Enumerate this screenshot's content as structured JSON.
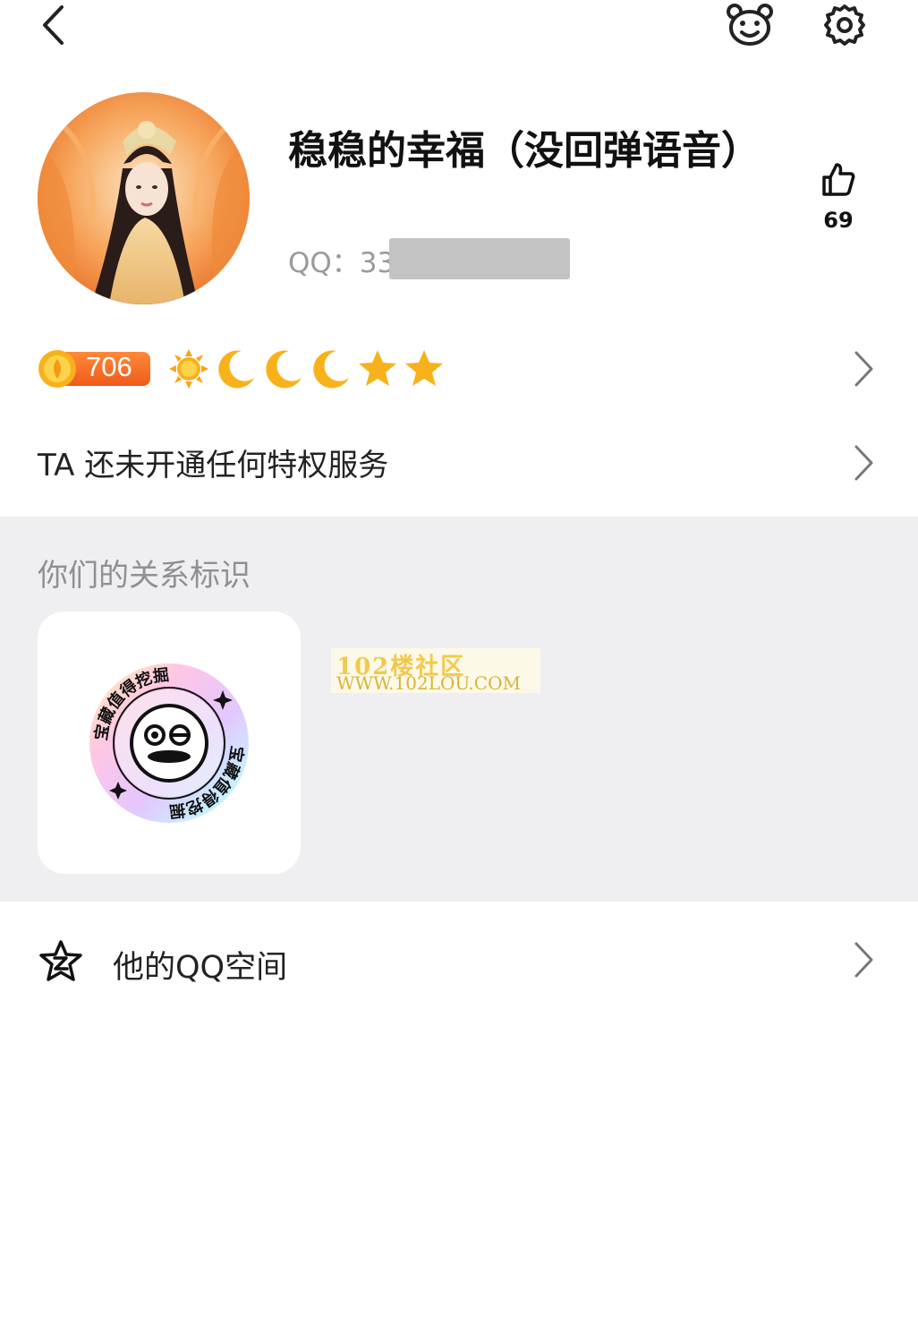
{
  "header": {
    "back_icon": "chevron-left-icon",
    "pet_icon": "bear-face-icon",
    "settings_icon": "gear-icon"
  },
  "profile": {
    "nickname": "稳稳的幸福（没回弹语音）",
    "qq_label": "QQ：33",
    "likes": "69",
    "like_icon": "thumbs-up-icon"
  },
  "level": {
    "value": "706",
    "icons": [
      "sun-icon",
      "moon-icon",
      "moon-icon",
      "moon-icon",
      "star-icon",
      "star-icon"
    ]
  },
  "privilege": {
    "text": "TA 还未开通任何特权服务"
  },
  "relationship": {
    "title": "你们的关系标识",
    "badge_text_top": "宝藏值得挖掘",
    "badge_text_bottom": "宝藏值得挖掘"
  },
  "watermark": {
    "line1": "102楼社区",
    "line2": "WWW.102LOU.COM"
  },
  "qzone": {
    "label": "他的QQ空间",
    "icon": "qzone-star-icon"
  },
  "colors": {
    "accent_orange": "#f2821f",
    "level_gold": "#f7b21b",
    "section_gray": "#efeff2",
    "muted_text": "#9a9a9a"
  }
}
